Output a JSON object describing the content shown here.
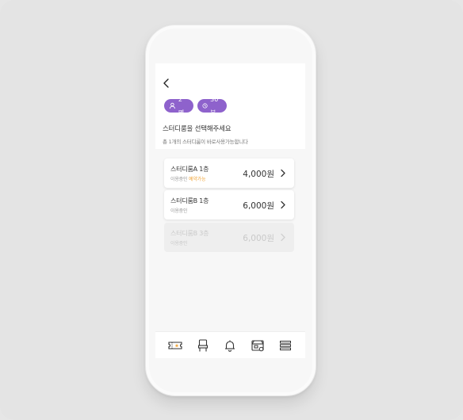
{
  "filters": {
    "people": "2명",
    "time": "30분"
  },
  "page": {
    "title": "스터디룸을 선택해주세요",
    "subtitle": "총 1개의 스터디룸이 바로사용가능합니다"
  },
  "rooms": [
    {
      "name": "스터디룸A 1층",
      "status_prefix": "이용중인",
      "status_highlight": "예약가능",
      "price": "4,000원",
      "enabled": true
    },
    {
      "name": "스터디룸B 1층",
      "status_prefix": "이용중인",
      "status_highlight": "",
      "price": "6,000원",
      "enabled": true
    },
    {
      "name": "스터디룸B 3층",
      "status_prefix": "이용중인",
      "status_highlight": "",
      "price": "6,000원",
      "enabled": false
    }
  ],
  "tabbar": {
    "icons": [
      "ticket-icon",
      "chair-icon",
      "bell-icon",
      "store-icon",
      "menu-icon"
    ]
  },
  "colors": {
    "accent": "#8e62cc",
    "available": "#f0a53a"
  }
}
